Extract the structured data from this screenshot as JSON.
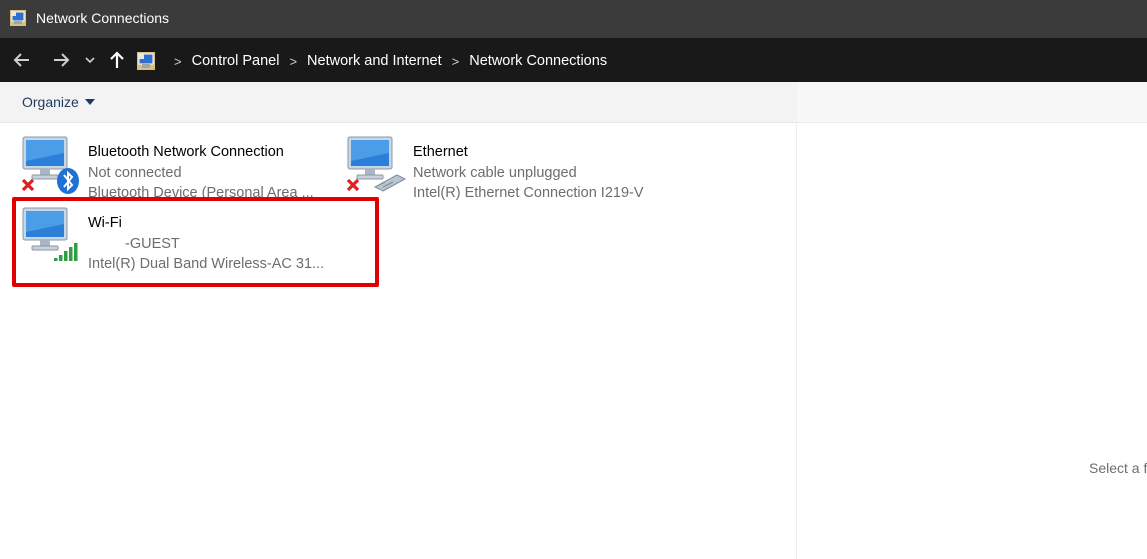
{
  "window": {
    "title": "Network Connections",
    "icon": "network-connections-icon"
  },
  "navigation": {
    "back_icon": "back-arrow-icon",
    "forward_icon": "forward-arrow-icon",
    "recent_icon": "chevron-down-icon",
    "up_icon": "up-arrow-icon",
    "breadcrumb": [
      "Control Panel",
      "Network and Internet",
      "Network Connections"
    ]
  },
  "toolbar": {
    "organize_label": "Organize"
  },
  "connections": [
    {
      "name": "Bluetooth Network Connection",
      "status": "Not connected",
      "device": "Bluetooth Device (Personal Area ...",
      "icon": "bluetooth-network-icon",
      "state": "disconnected"
    },
    {
      "name": "Ethernet",
      "status": "Network cable unplugged",
      "device": "Intel(R) Ethernet Connection I219-V",
      "icon": "ethernet-network-icon",
      "state": "disconnected"
    },
    {
      "name": "Wi-Fi",
      "status": "-GUEST",
      "device": "Intel(R) Dual Band Wireless-AC 31...",
      "icon": "wifi-network-icon",
      "state": "connected"
    }
  ],
  "preview": {
    "text": "Select a f"
  },
  "colors": {
    "titlebar": "#3b3b3b",
    "navbar": "#191919",
    "highlight": "#e00000",
    "secondary_text": "#6d6d6d",
    "link": "#1e3a5f"
  }
}
